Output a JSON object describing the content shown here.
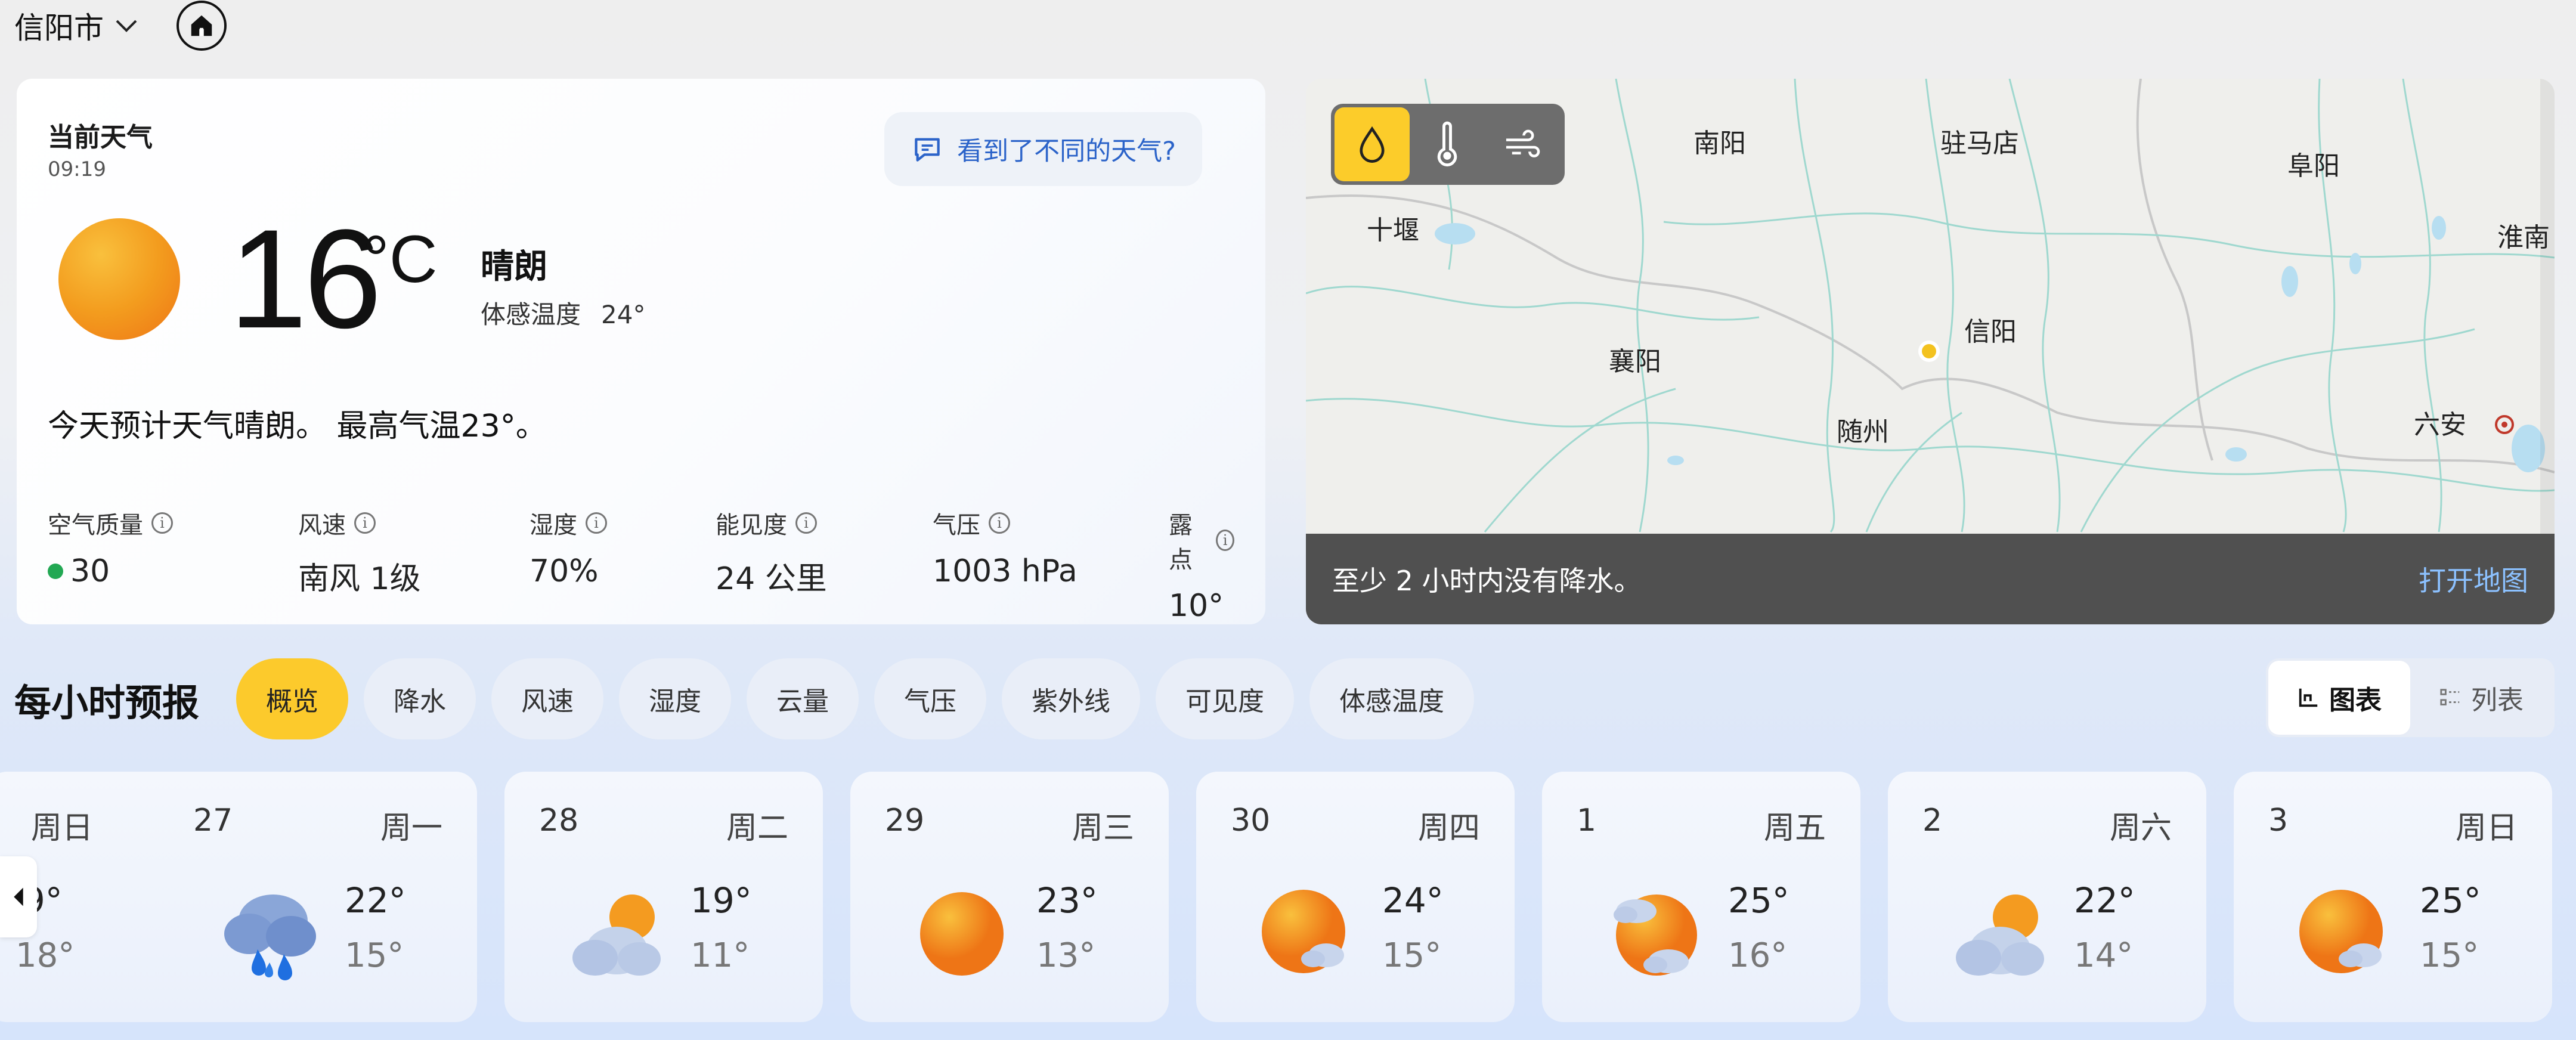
{
  "location": {
    "city": "信阳市"
  },
  "current": {
    "title": "当前天气",
    "time": "09:19",
    "feedback": "看到了不同的天气?",
    "temp": "16",
    "unit": "°C",
    "condition": "晴朗",
    "feels_label": "体感温度",
    "feels_value": "24°",
    "summary": "今天预计天气晴朗。 最高气温23°。",
    "metrics": [
      {
        "label": "空气质量",
        "value": "30"
      },
      {
        "label": "风速",
        "value": "南风 1级"
      },
      {
        "label": "湿度",
        "value": "70%"
      },
      {
        "label": "能见度",
        "value": "24 公里"
      },
      {
        "label": "气压",
        "value": "1003 hPa"
      },
      {
        "label": "露点",
        "value": "10°"
      }
    ]
  },
  "map": {
    "cities": [
      "南阳",
      "驻马店",
      "阜阳",
      "十堰",
      "淮南",
      "信阳",
      "襄阳",
      "随州",
      "六安"
    ],
    "message": "至少 2 小时内没有降水。",
    "open_link": "打开地图",
    "layers": [
      "precip-icon",
      "thermometer-icon",
      "wind-icon"
    ],
    "active_layer": "precip-icon"
  },
  "hourly": {
    "title": "每小时预报",
    "tabs": [
      "概览",
      "降水",
      "风速",
      "湿度",
      "云量",
      "气压",
      "紫外线",
      "可见度",
      "体感温度"
    ],
    "active_tab": "概览",
    "view_chart": "图表",
    "view_list": "列表"
  },
  "days": [
    {
      "date": "",
      "weekday": "周日",
      "hi": "19°",
      "lo": "18°",
      "icon": "partial"
    },
    {
      "date": "27",
      "weekday": "周一",
      "hi": "22°",
      "lo": "15°",
      "icon": "rain"
    },
    {
      "date": "28",
      "weekday": "周二",
      "hi": "19°",
      "lo": "11°",
      "icon": "cloudy-sun"
    },
    {
      "date": "29",
      "weekday": "周三",
      "hi": "23°",
      "lo": "13°",
      "icon": "sun"
    },
    {
      "date": "30",
      "weekday": "周四",
      "hi": "24°",
      "lo": "15°",
      "icon": "sun-small-cloud"
    },
    {
      "date": "1",
      "weekday": "周五",
      "hi": "25°",
      "lo": "16°",
      "icon": "sun-clouds"
    },
    {
      "date": "2",
      "weekday": "周六",
      "hi": "22°",
      "lo": "14°",
      "icon": "cloudy-sun"
    },
    {
      "date": "3",
      "weekday": "周日",
      "hi": "25°",
      "lo": "15°",
      "icon": "sun-small-cloud"
    }
  ],
  "colors": {
    "accent": "#fccc2a",
    "link": "#2b63c9",
    "aqi_good": "#22a853"
  }
}
